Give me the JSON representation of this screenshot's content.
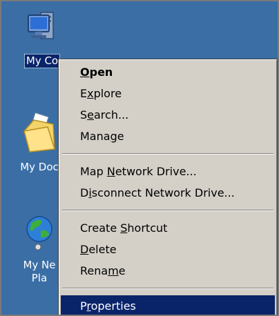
{
  "colors": {
    "desktop": "#3a6ea5",
    "menu_bg": "#d4d0c8",
    "highlight": "#0a246a",
    "highlight_text": "#ffffff"
  },
  "desktop": {
    "icons": [
      {
        "name": "my-computer",
        "icon": "computer-icon",
        "label": "My Co",
        "selected": true
      },
      {
        "name": "my-documents",
        "icon": "folder-documents-icon",
        "label": "My Doc"
      },
      {
        "name": "my-network-places",
        "icon": "network-globe-icon",
        "label_line1": "My Ne",
        "label_line2": "Pla"
      }
    ]
  },
  "context_menu": {
    "groups": [
      [
        {
          "pre": "",
          "key": "O",
          "post": "pen",
          "bold": true
        },
        {
          "pre": "E",
          "key": "x",
          "post": "plore"
        },
        {
          "pre": "S",
          "key": "e",
          "post": "arch..."
        },
        {
          "pre": "Mana",
          "key": "g",
          "post": "e"
        }
      ],
      [
        {
          "pre": "Map ",
          "key": "N",
          "post": "etwork Drive..."
        },
        {
          "pre": "D",
          "key": "i",
          "post": "sconnect Network Drive..."
        }
      ],
      [
        {
          "pre": "Create ",
          "key": "S",
          "post": "hortcut"
        },
        {
          "pre": "",
          "key": "D",
          "post": "elete"
        },
        {
          "pre": "Rena",
          "key": "m",
          "post": "e"
        }
      ],
      [
        {
          "pre": "P",
          "key": "r",
          "post": "operties",
          "highlighted": true
        }
      ]
    ]
  }
}
